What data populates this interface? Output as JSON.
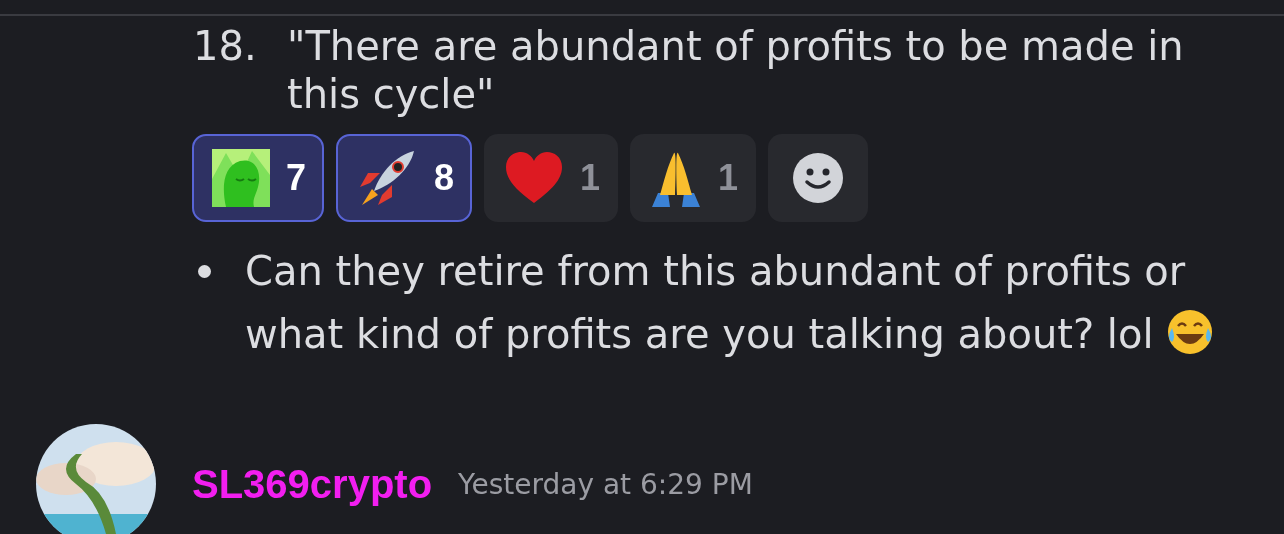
{
  "list_item": {
    "number": "18.",
    "text": "\"There are abundant of profits to be made in this cycle\""
  },
  "reactions": [
    {
      "kind": "custom",
      "count": "7",
      "selected": true
    },
    {
      "kind": "rocket",
      "count": "8",
      "selected": true
    },
    {
      "kind": "heart",
      "count": "1",
      "selected": false
    },
    {
      "kind": "hands",
      "count": "1",
      "selected": false
    }
  ],
  "add_reaction": {
    "kind": "smiley"
  },
  "bullet": {
    "text": "Can they retire from this abundant of profits or what kind of profits are you talking about? lol"
  },
  "next_message": {
    "author": "SL369crypto",
    "timestamp": "Yesterday at 6:29 PM"
  }
}
